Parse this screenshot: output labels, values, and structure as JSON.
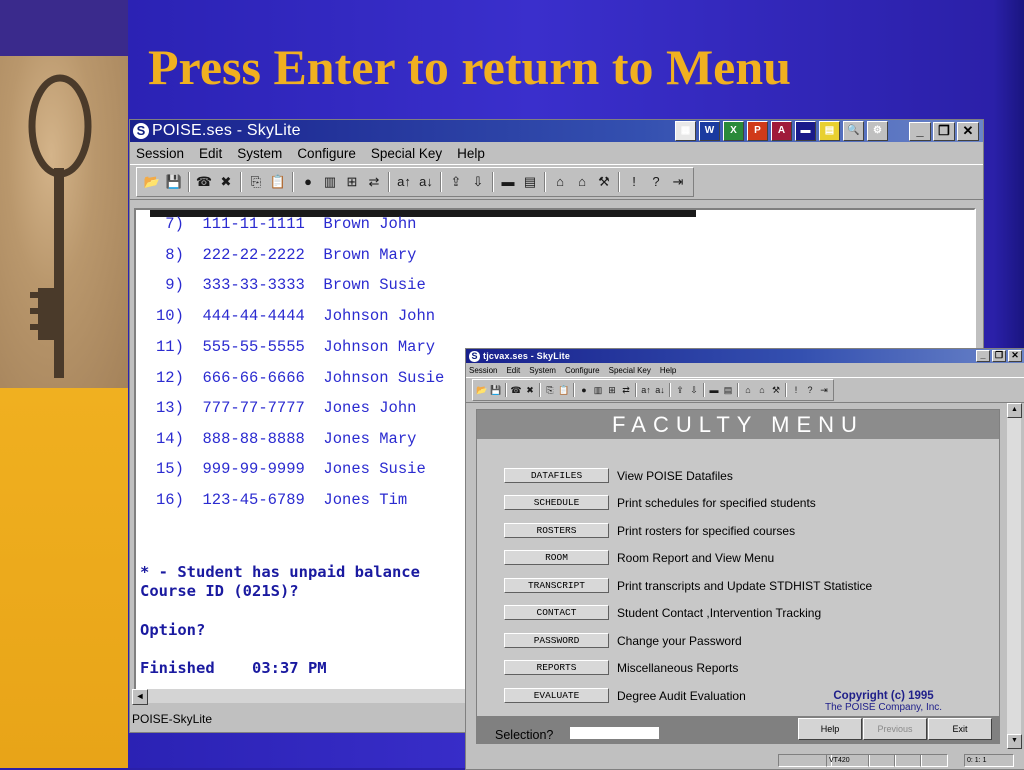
{
  "slide": {
    "title": "Press Enter to return to Menu"
  },
  "window1": {
    "title": "POISE.ses - SkyLite",
    "menu": [
      "Session",
      "Edit",
      "System",
      "Configure",
      "Special Key",
      "Help"
    ],
    "terminal_lines": [
      " 7)  111-11-1111  Brown John",
      " 8)  222-22-2222  Brown Mary",
      " 9)  333-33-3333  Brown Susie",
      "10)  444-44-4444  Johnson John",
      "11)  555-55-5555  Johnson Mary",
      "12)  666-66-6666  Johnson Susie",
      "13)  777-77-7777  Jones John",
      "14)  888-88-8888  Jones Mary",
      "15)  999-99-9999  Jones Susie",
      "16)  123-45-6789  Jones Tim"
    ],
    "note": "* - Student has unpaid balance",
    "prompt_course": "Course ID (021S)?",
    "prompt_option": "Option?",
    "finished": "Finished    03:37 PM",
    "status": "POISE-SkyLite"
  },
  "window2": {
    "title": "tjcvax.ses - SkyLite",
    "menu": [
      "Session",
      "Edit",
      "System",
      "Configure",
      "Special Key",
      "Help"
    ],
    "header": "FACULTY  MENU",
    "items": [
      {
        "button": "DATAFILES",
        "desc": "View POISE Datafiles"
      },
      {
        "button": "SCHEDULE",
        "desc": "Print schedules for specified students"
      },
      {
        "button": "ROSTERS",
        "desc": "Print rosters for specified courses"
      },
      {
        "button": "ROOM",
        "desc": "Room Report and View Menu"
      },
      {
        "button": "TRANSCRIPT",
        "desc": "Print transcripts and Update STDHIST Statistice"
      },
      {
        "button": "CONTACT",
        "desc": "Student Contact ,Intervention Tracking"
      },
      {
        "button": "PASSWORD",
        "desc": "Change your Password"
      },
      {
        "button": "REPORTS",
        "desc": "Miscellaneous Reports"
      },
      {
        "button": "EVALUATE",
        "desc": "Degree Audit Evaluation"
      }
    ],
    "copyright_line1": "Copyright (c) 1995",
    "copyright_line2": "The POISE Company, Inc.",
    "selection_label": "Selection?",
    "selection_value": "",
    "buttons": {
      "help": "Help",
      "previous": "Previous",
      "exit": "Exit"
    },
    "status_terminal": "VT420",
    "status_position": "0: 1: 1"
  }
}
